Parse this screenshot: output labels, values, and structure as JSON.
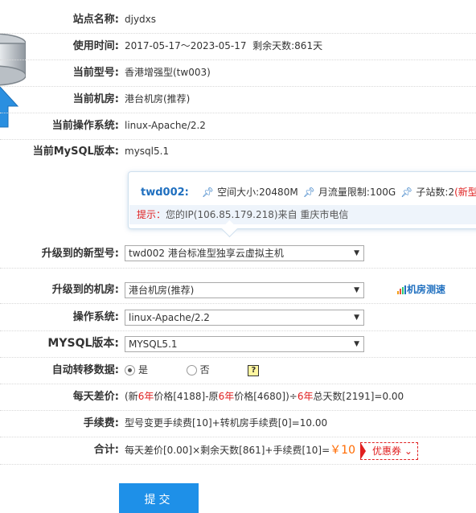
{
  "site": {
    "name_label": "站点名称:",
    "name_value": "djydxs"
  },
  "usage": {
    "label": "使用时间:",
    "range": "2017-05-17～2023-05-17",
    "remaining": "剩余天数:861天"
  },
  "current_model": {
    "label": "当前型号:",
    "value": "香港增强型(tw003)"
  },
  "current_room": {
    "label": "当前机房:",
    "value": "港台机房(推荐)"
  },
  "current_os": {
    "label": "当前操作系统:",
    "value": "linux-Apache/2.2"
  },
  "current_mysql": {
    "label": "当前MySQL版本:",
    "value": "mysql5.1"
  },
  "tip": {
    "model": "twd002:",
    "space": "空间大小:20480M",
    "traffic": "月流量限制:100G",
    "subsites": "子站数:2",
    "new_tag": "(新型号)",
    "hint_label": "提示：",
    "hint_text": "您的IP(106.85.179.218)来自 重庆市电信"
  },
  "upgrade_model": {
    "label": "升级到的新型号:",
    "selected": "twd002 港台标准型独享云虚拟主机"
  },
  "upgrade_room": {
    "label": "升级到的机房:",
    "selected": "港台机房(推荐)",
    "speed_link": "机房测速"
  },
  "os": {
    "label": "操作系统:",
    "selected": "linux-Apache/2.2"
  },
  "mysql": {
    "label": "MYSQL版本:",
    "selected": "MYSQL5.1"
  },
  "auto_transfer": {
    "label": "自动转移数据:",
    "yes": "是",
    "no": "否",
    "selected": "yes",
    "help": "?"
  },
  "daily_diff": {
    "label": "每天差价:",
    "p1": "(新",
    "y1": "6年",
    "p2": "价格[4188]-原",
    "y2": "6年",
    "p3": "价格[4680])÷",
    "y3": "6年",
    "p4": "总天数[2191]=0.00"
  },
  "fee": {
    "label": "手续费:",
    "value": "型号变更手续费[10]+转机房手续费[0]=10.00"
  },
  "total": {
    "label": "合计:",
    "formula": "每天差价[0.00]×剩余天数[861]+手续费[10]=",
    "price": "￥10",
    "coupon": "优惠券",
    "coupon_caret": "⌄"
  },
  "submit_label": "提交",
  "colors": {
    "accent_blue": "#1e90e8",
    "link_blue": "#1f6fbf",
    "red": "#e02020",
    "price_orange": "#ff6a00"
  }
}
